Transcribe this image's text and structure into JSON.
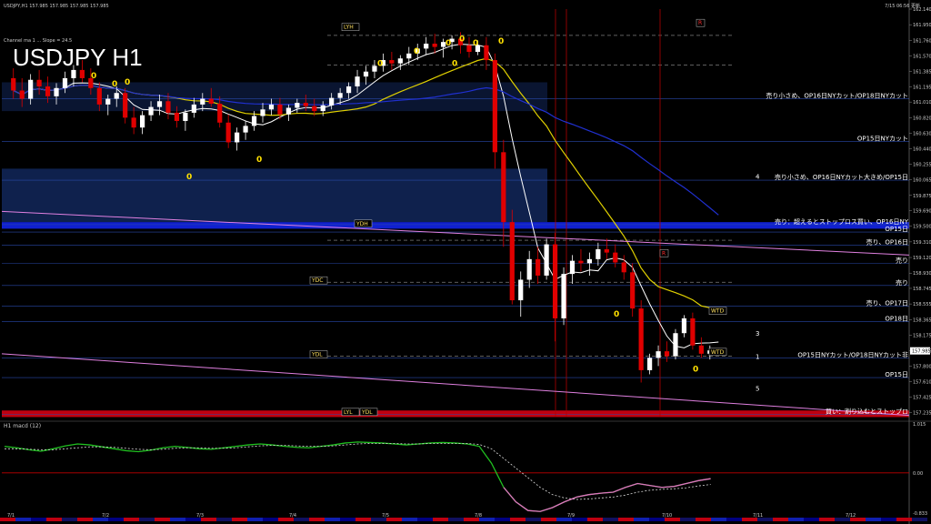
{
  "header": {
    "symbol_info": "USDJPY,H1  157.985 157.985 157.985 157.985",
    "indicator_info": "Channel ma 1 ... Slope = 24.5",
    "big_title": "USDJPY H1",
    "top_right": "7/15 06:56 更新"
  },
  "colors": {
    "bull": "#ffffff",
    "bear": "#e00000",
    "ma_white": "#ffffff",
    "ma_yellow": "#e0d000",
    "ma_blue": "#2030d0",
    "magenta": "#e080e0",
    "green": "#20c020",
    "panel_bg": "#000000",
    "grid_blue": "#1c3c8c"
  },
  "chart_data": [
    {
      "type": "candlestick",
      "title": "USDJPY H1",
      "ylim": [
        157.185,
        162.14
      ],
      "price_axis_ticks": [
        "162.140",
        "161.950",
        "161.760",
        "161.570",
        "161.385",
        "161.195",
        "161.010",
        "160.820",
        "160.630",
        "160.440",
        "160.255",
        "160.065",
        "159.875",
        "159.690",
        "159.500",
        "159.310",
        "159.120",
        "158.930",
        "158.745",
        "158.555",
        "158.365",
        "158.175",
        "157.985",
        "157.800",
        "157.610",
        "157.425",
        "157.235"
      ],
      "x_date_labels": [
        "7/1",
        "7/2",
        "7/3",
        "7/4",
        "7/5",
        "7/8",
        "7/9",
        "7/10",
        "7/11",
        "7/12"
      ],
      "price_badge": "157.985",
      "level_tags": [
        "LYH",
        "YDH",
        "YDC",
        "YDL",
        "LYL",
        "YDL",
        "WTD",
        "WTD",
        "R",
        "R",
        "0",
        "0",
        "0",
        "0",
        "0",
        "0",
        "0",
        "0",
        "0",
        "0",
        "0",
        "0",
        "0",
        "0"
      ],
      "zone_labels": [
        {
          "text": "売り小さめ、OP16日NYカット/OP18日NYカット",
          "price": 161.05
        },
        {
          "text": "OP15日NYカット",
          "price": 160.53
        },
        {
          "text": "売り小さめ、OP16日NYカット大きめ/OP15日",
          "price": 160.06
        },
        {
          "text": "売り：超えるとストップロス買い、OP16日NY",
          "price": 159.52
        },
        {
          "text": "OP15日",
          "price": 159.43
        },
        {
          "text": "売り、OP16日",
          "price": 159.27
        },
        {
          "text": "売り",
          "price": 159.05
        },
        {
          "text": "売り",
          "price": 158.78
        },
        {
          "text": "売り、OP17日",
          "price": 158.53
        },
        {
          "text": "OP18日",
          "price": 158.34
        },
        {
          "text": "OP15日NYカット/OP18日NYカット非",
          "price": 157.9
        },
        {
          "text": "OP15日",
          "price": 157.66
        },
        {
          "text": "買い：割り込むとストップロ",
          "price": 157.21
        }
      ],
      "wave_labels": [
        "4",
        "3",
        "1",
        "5"
      ],
      "ohlc": [
        [
          161.3,
          161.42,
          161.05,
          161.15
        ],
        [
          161.15,
          161.3,
          160.95,
          161.05
        ],
        [
          161.05,
          161.35,
          160.98,
          161.28
        ],
        [
          161.28,
          161.4,
          161.1,
          161.2
        ],
        [
          161.2,
          161.32,
          161.0,
          161.08
        ],
        [
          161.08,
          161.24,
          160.98,
          161.18
        ],
        [
          161.18,
          161.38,
          161.12,
          161.3
        ],
        [
          161.3,
          161.46,
          161.2,
          161.4
        ],
        [
          161.4,
          161.52,
          161.25,
          161.3
        ],
        [
          161.3,
          161.42,
          161.1,
          161.18
        ],
        [
          161.18,
          161.25,
          160.9,
          160.98
        ],
        [
          160.98,
          161.1,
          160.85,
          161.05
        ],
        [
          161.05,
          161.2,
          160.95,
          161.12
        ],
        [
          161.12,
          161.18,
          160.75,
          160.82
        ],
        [
          160.82,
          160.95,
          160.62,
          160.7
        ],
        [
          160.7,
          160.9,
          160.62,
          160.85
        ],
        [
          160.85,
          161.02,
          160.78,
          160.95
        ],
        [
          160.95,
          161.1,
          160.85,
          161.02
        ],
        [
          161.02,
          161.12,
          160.8,
          160.88
        ],
        [
          160.88,
          160.96,
          160.7,
          160.78
        ],
        [
          160.78,
          160.92,
          160.66,
          160.88
        ],
        [
          160.88,
          161.06,
          160.82,
          160.98
        ],
        [
          160.98,
          161.12,
          160.9,
          161.05
        ],
        [
          161.05,
          161.18,
          160.95,
          160.99
        ],
        [
          160.99,
          161.08,
          160.7,
          160.76
        ],
        [
          160.76,
          160.86,
          160.45,
          160.52
        ],
        [
          160.52,
          160.7,
          160.42,
          160.64
        ],
        [
          160.64,
          160.78,
          160.55,
          160.72
        ],
        [
          160.72,
          160.9,
          160.66,
          160.84
        ],
        [
          160.84,
          161.0,
          160.76,
          160.92
        ],
        [
          160.92,
          161.05,
          160.85,
          160.98
        ],
        [
          160.98,
          161.06,
          160.8,
          160.86
        ],
        [
          160.86,
          160.98,
          160.78,
          160.94
        ],
        [
          160.94,
          161.05,
          160.88,
          161.0
        ],
        [
          161.0,
          161.1,
          160.9,
          160.96
        ],
        [
          160.96,
          161.05,
          160.84,
          160.9
        ],
        [
          160.9,
          161.02,
          160.84,
          160.97
        ],
        [
          160.97,
          161.12,
          160.92,
          161.06
        ],
        [
          161.06,
          161.18,
          160.98,
          161.12
        ],
        [
          161.12,
          161.25,
          161.05,
          161.2
        ],
        [
          161.2,
          161.4,
          161.12,
          161.32
        ],
        [
          161.32,
          161.45,
          161.22,
          161.38
        ],
        [
          161.38,
          161.52,
          161.3,
          161.45
        ],
        [
          161.45,
          161.6,
          161.38,
          161.52
        ],
        [
          161.52,
          161.62,
          161.4,
          161.48
        ],
        [
          161.48,
          161.58,
          161.4,
          161.54
        ],
        [
          161.54,
          161.68,
          161.46,
          161.6
        ],
        [
          161.6,
          161.72,
          161.52,
          161.66
        ],
        [
          161.66,
          161.8,
          161.58,
          161.72
        ],
        [
          161.72,
          161.84,
          161.6,
          161.68
        ],
        [
          161.68,
          161.78,
          161.55,
          161.74
        ],
        [
          161.74,
          161.82,
          161.65,
          161.78
        ],
        [
          161.78,
          161.86,
          161.6,
          161.7
        ],
        [
          161.7,
          161.8,
          161.55,
          161.62
        ],
        [
          161.62,
          161.76,
          161.58,
          161.7
        ],
        [
          161.7,
          161.8,
          161.4,
          161.52
        ],
        [
          161.52,
          161.6,
          160.2,
          160.4
        ],
        [
          160.4,
          160.55,
          159.25,
          159.55
        ],
        [
          159.55,
          159.7,
          158.55,
          158.6
        ],
        [
          158.6,
          158.95,
          158.4,
          158.85
        ],
        [
          158.85,
          159.2,
          158.75,
          159.1
        ],
        [
          159.1,
          159.25,
          158.8,
          158.9
        ],
        [
          158.9,
          159.35,
          158.85,
          159.28
        ],
        [
          159.28,
          159.42,
          158.1,
          158.38
        ],
        [
          158.38,
          159.0,
          158.3,
          158.92
        ],
        [
          158.92,
          159.15,
          158.8,
          159.08
        ],
        [
          159.08,
          159.22,
          158.95,
          159.05
        ],
        [
          159.05,
          159.18,
          158.9,
          159.1
        ],
        [
          159.1,
          159.3,
          159.02,
          159.22
        ],
        [
          159.22,
          159.35,
          159.1,
          159.18
        ],
        [
          159.18,
          159.28,
          159.0,
          159.06
        ],
        [
          159.06,
          159.15,
          158.85,
          158.94
        ],
        [
          158.94,
          159.05,
          158.4,
          158.5
        ],
        [
          158.5,
          158.6,
          157.6,
          157.75
        ],
        [
          157.75,
          157.95,
          157.7,
          157.9
        ],
        [
          157.9,
          158.05,
          157.8,
          157.98
        ],
        [
          157.98,
          158.1,
          157.85,
          157.92
        ],
        [
          157.92,
          158.25,
          157.88,
          158.2
        ],
        [
          158.2,
          158.42,
          158.15,
          158.38
        ],
        [
          158.38,
          158.45,
          158.0,
          158.05
        ],
        [
          158.05,
          158.15,
          157.9,
          157.95
        ],
        [
          157.95,
          158.05,
          157.88,
          157.99
        ],
        [
          157.99,
          158.02,
          157.94,
          157.985
        ]
      ],
      "macd_panel": {
        "label": "H1 macd (12)",
        "ticks": [
          "1.015",
          "0.00",
          "-0.833"
        ],
        "macd": [
          0.55,
          0.52,
          0.48,
          0.45,
          0.5,
          0.56,
          0.6,
          0.58,
          0.54,
          0.5,
          0.46,
          0.44,
          0.47,
          0.52,
          0.55,
          0.53,
          0.5,
          0.49,
          0.52,
          0.55,
          0.58,
          0.6,
          0.58,
          0.55,
          0.53,
          0.52,
          0.55,
          0.58,
          0.62,
          0.64,
          0.63,
          0.62,
          0.6,
          0.58,
          0.6,
          0.62,
          0.63,
          0.62,
          0.6,
          0.55,
          0.2,
          -0.3,
          -0.6,
          -0.78,
          -0.8,
          -0.72,
          -0.6,
          -0.5,
          -0.45,
          -0.42,
          -0.4,
          -0.3,
          -0.22,
          -0.26,
          -0.3,
          -0.28,
          -0.22,
          -0.16,
          -0.12
        ],
        "signal": [
          0.5,
          0.5,
          0.49,
          0.48,
          0.48,
          0.5,
          0.52,
          0.54,
          0.54,
          0.53,
          0.51,
          0.49,
          0.48,
          0.49,
          0.51,
          0.52,
          0.52,
          0.51,
          0.51,
          0.52,
          0.54,
          0.56,
          0.57,
          0.57,
          0.56,
          0.55,
          0.55,
          0.56,
          0.58,
          0.6,
          0.61,
          0.61,
          0.61,
          0.6,
          0.6,
          0.61,
          0.61,
          0.61,
          0.61,
          0.59,
          0.5,
          0.3,
          0.1,
          -0.1,
          -0.3,
          -0.45,
          -0.52,
          -0.55,
          -0.54,
          -0.52,
          -0.5,
          -0.46,
          -0.4,
          -0.36,
          -0.34,
          -0.33,
          -0.31,
          -0.27,
          -0.24
        ]
      }
    }
  ]
}
